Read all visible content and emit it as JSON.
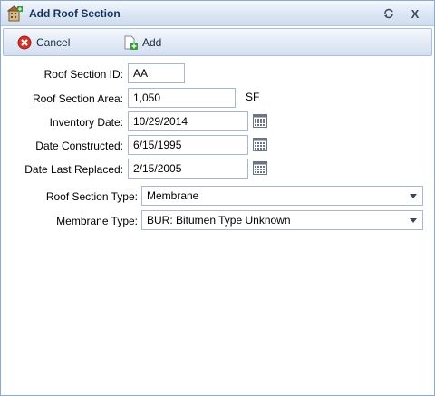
{
  "window": {
    "title": "Add Roof Section",
    "refresh_icon": "refresh-icon",
    "close_label": "X"
  },
  "toolbar": {
    "cancel_label": "Cancel",
    "add_label": "Add"
  },
  "form": {
    "roof_section_id": {
      "label": "Roof Section ID:",
      "value": "AA"
    },
    "roof_section_area": {
      "label": "Roof Section Area:",
      "value": "1,050",
      "unit": "SF"
    },
    "inventory_date": {
      "label": "Inventory Date:",
      "value": "10/29/2014"
    },
    "date_constructed": {
      "label": "Date Constructed:",
      "value": "6/15/1995"
    },
    "date_last_replaced": {
      "label": "Date Last Replaced:",
      "value": "2/15/2005"
    },
    "roof_section_type": {
      "label": "Roof Section Type:",
      "value": "Membrane"
    },
    "membrane_type": {
      "label": "Membrane Type:",
      "value": "BUR: Bitumen Type Unknown"
    }
  },
  "colors": {
    "title_text": "#15325f",
    "cancel_red": "#d0352c",
    "add_green": "#3a9a3a",
    "border_blue": "#8ea9cf"
  }
}
